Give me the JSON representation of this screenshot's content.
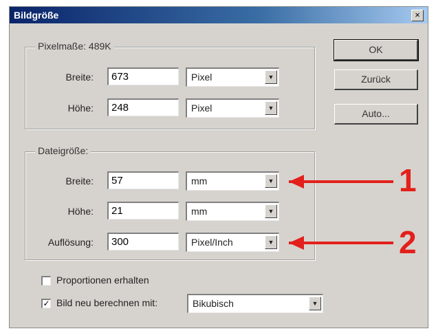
{
  "window": {
    "title": "Bildgröße",
    "close_glyph": "×"
  },
  "pixel_dimensions": {
    "legend": "Pixelmaße: 489K",
    "width_label": "Breite:",
    "width_value": "673",
    "width_unit": "Pixel",
    "height_label": "Höhe:",
    "height_value": "248",
    "height_unit": "Pixel"
  },
  "document_size": {
    "legend": "Dateigröße:",
    "width_label": "Breite:",
    "width_value": "57",
    "width_unit": "mm",
    "height_label": "Höhe:",
    "height_value": "21",
    "height_unit": "mm",
    "resolution_label": "Auflösung:",
    "resolution_value": "300",
    "resolution_unit": "Pixel/Inch"
  },
  "options": {
    "constrain_label": "Proportionen erhalten",
    "constrain_checked": false,
    "resample_label": "Bild neu berechnen mit:",
    "resample_checked": true,
    "resample_method": "Bikubisch"
  },
  "buttons": {
    "ok": "OK",
    "reset": "Zurück",
    "auto": "Auto..."
  },
  "annotations": {
    "arrow1": "1",
    "arrow2": "2",
    "color": "#e3201b"
  },
  "icons": {
    "dropdown": "chevron-down-icon",
    "check": "checkmark-icon"
  }
}
